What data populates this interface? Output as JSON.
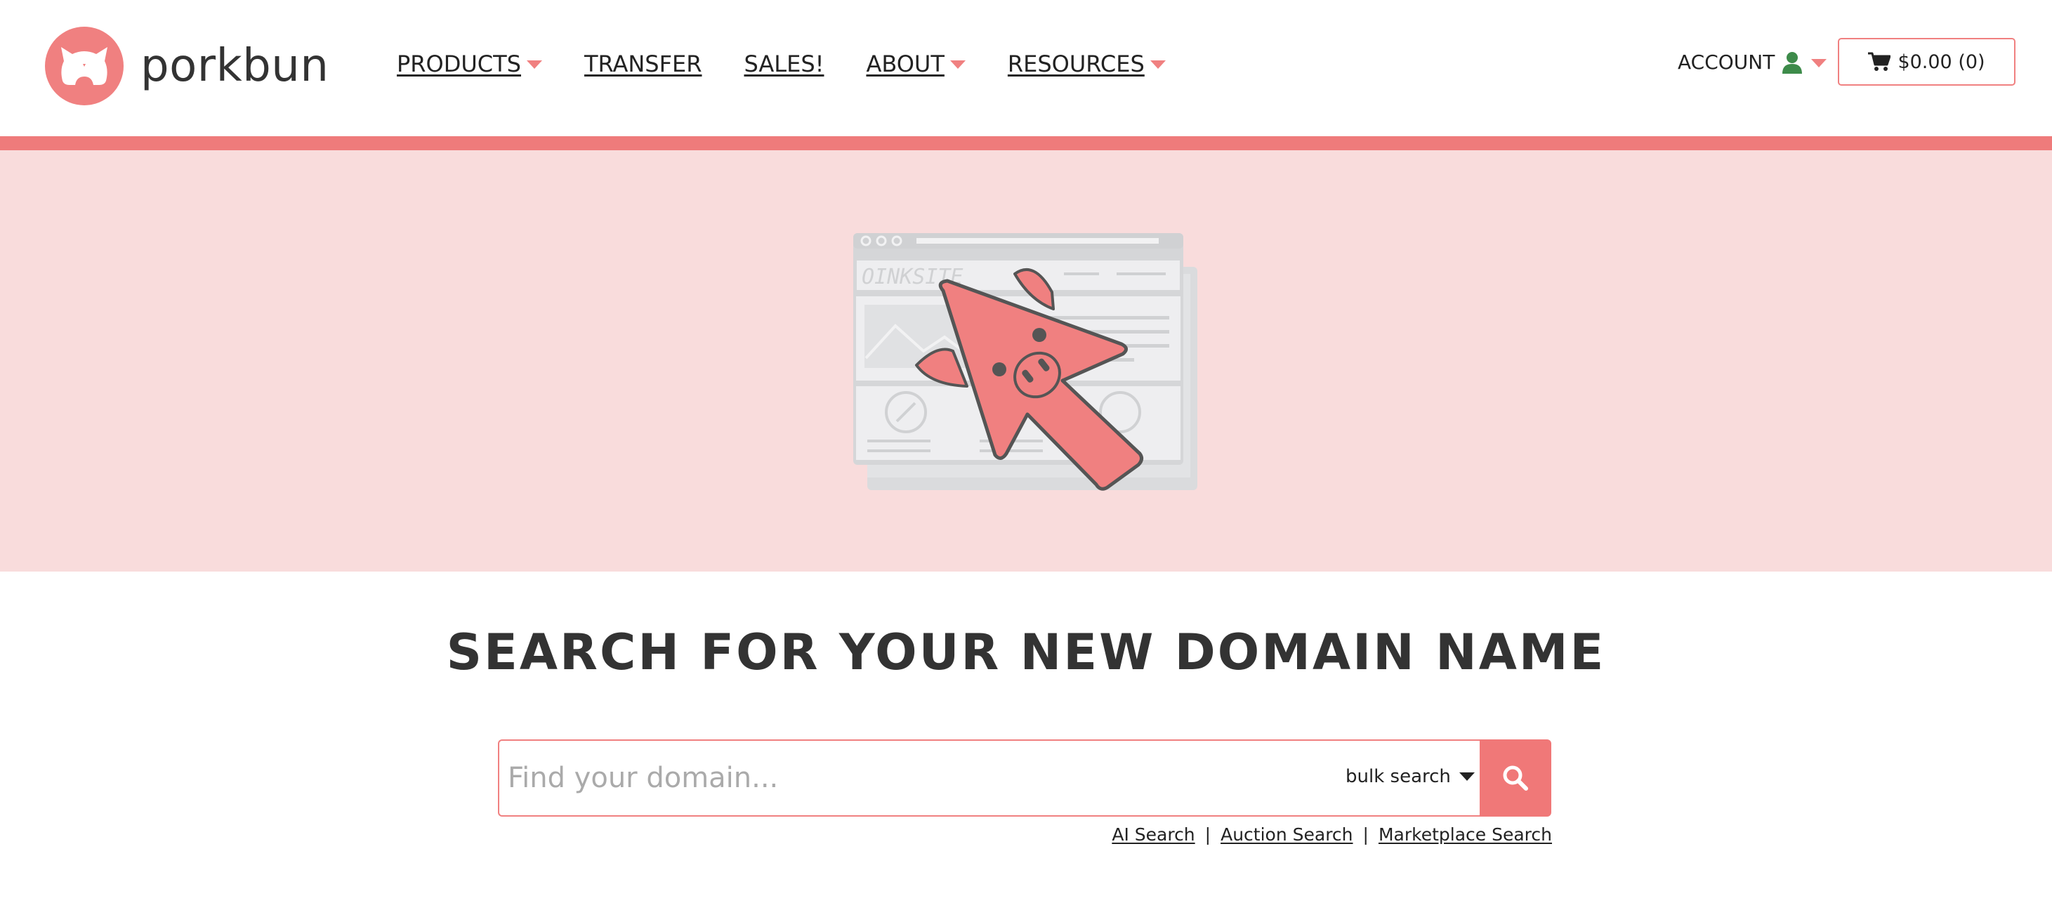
{
  "brand": {
    "name": "porkbun",
    "accent_color": "#f08080",
    "hero_background": "#f9dcdc",
    "logo_icon": "pig-bun-icon"
  },
  "nav": {
    "items": [
      {
        "label": "PRODUCTS",
        "has_dropdown": true
      },
      {
        "label": "TRANSFER",
        "has_dropdown": false
      },
      {
        "label": "SALES!",
        "has_dropdown": false
      },
      {
        "label": "ABOUT",
        "has_dropdown": true
      },
      {
        "label": "RESOURCES",
        "has_dropdown": true
      }
    ]
  },
  "account": {
    "label": "ACCOUNT",
    "icon": "user-icon",
    "icon_color": "#3d8b4a"
  },
  "cart": {
    "label": "$0.00 (0)",
    "icon": "cart-icon"
  },
  "hero": {
    "illustration": "pig-cursor-oinksite-illustration",
    "illustration_text": "OINKSITE"
  },
  "search": {
    "title": "SEARCH FOR YOUR NEW DOMAIN NAME",
    "placeholder": "Find your domain...",
    "value": "",
    "bulk_label": "bulk search",
    "button_icon": "search-icon",
    "links": [
      {
        "label": "AI Search"
      },
      {
        "label": "Auction Search"
      },
      {
        "label": "Marketplace Search"
      }
    ],
    "separator": "|"
  }
}
